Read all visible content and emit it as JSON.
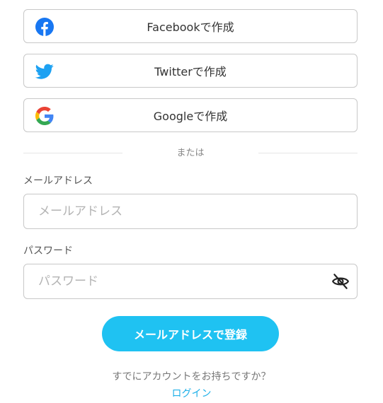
{
  "social": {
    "facebook_label": "Facebookで作成",
    "twitter_label": "Twitterで作成",
    "google_label": "Googleで作成"
  },
  "divider": {
    "text": "または"
  },
  "email": {
    "label": "メールアドレス",
    "placeholder": "メールアドレス",
    "value": ""
  },
  "password": {
    "label": "パスワード",
    "placeholder": "パスワード",
    "value": ""
  },
  "submit": {
    "label": "メールアドレスで登録"
  },
  "footer": {
    "question": "すでにアカウントをお持ちですか？",
    "login_label": "ログイン"
  },
  "colors": {
    "accent": "#1fc2f2",
    "link": "#1fb0e8",
    "facebook": "#1877f2",
    "twitter": "#1da1f2",
    "border": "#c8c8c8"
  },
  "icons": {
    "facebook": "facebook-icon",
    "twitter": "twitter-icon",
    "google": "google-icon",
    "password_toggle": "eye-off-icon"
  }
}
